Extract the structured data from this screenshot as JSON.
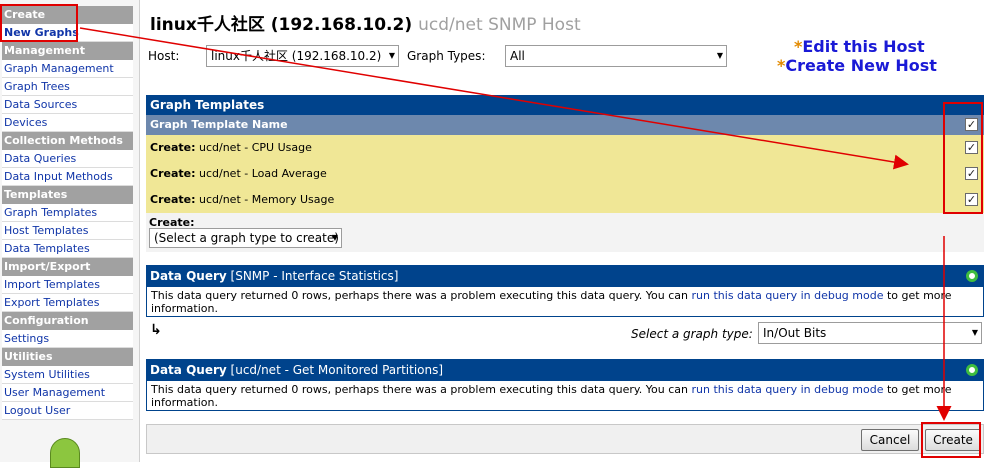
{
  "sidebar": {
    "sections": [
      {
        "title": "Create",
        "items": [
          {
            "label": "New Graphs",
            "active": true
          }
        ]
      },
      {
        "title": "Management",
        "items": [
          {
            "label": "Graph Management"
          },
          {
            "label": "Graph Trees"
          },
          {
            "label": "Data Sources"
          },
          {
            "label": "Devices"
          }
        ]
      },
      {
        "title": "Collection Methods",
        "items": [
          {
            "label": "Data Queries"
          },
          {
            "label": "Data Input Methods"
          }
        ]
      },
      {
        "title": "Templates",
        "items": [
          {
            "label": "Graph Templates"
          },
          {
            "label": "Host Templates"
          },
          {
            "label": "Data Templates"
          }
        ]
      },
      {
        "title": "Import/Export",
        "items": [
          {
            "label": "Import Templates"
          },
          {
            "label": "Export Templates"
          }
        ]
      },
      {
        "title": "Configuration",
        "items": [
          {
            "label": "Settings"
          }
        ]
      },
      {
        "title": "Utilities",
        "items": [
          {
            "label": "System Utilities"
          },
          {
            "label": "User Management"
          },
          {
            "label": "Logout User"
          }
        ]
      }
    ]
  },
  "header": {
    "title": "linux千人社区 (192.168.10.2)",
    "subtitle": "ucd/net SNMP Host"
  },
  "filters": {
    "host_label": "Host:",
    "host_value": "linux千人社区 (192.168.10.2)",
    "graph_types_label": "Graph Types:",
    "graph_types_value": "All"
  },
  "host_links": {
    "edit": "Edit this Host",
    "create": "Create New Host",
    "star": "*"
  },
  "graph_templates": {
    "title": "Graph Templates",
    "column_header": "Graph Template Name",
    "create_prefix": "Create:",
    "rows": [
      {
        "name": "ucd/net - CPU Usage",
        "checked": true
      },
      {
        "name": "ucd/net - Load Average",
        "checked": true
      },
      {
        "name": "ucd/net - Memory Usage",
        "checked": true
      }
    ],
    "create_label": "Create:",
    "create_select": "(Select a graph type to create)"
  },
  "data_queries": [
    {
      "prefix": "Data Query",
      "name": "[SNMP - Interface Statistics]",
      "message_before": "This data query returned 0 rows, perhaps there was a problem executing this data query. You can",
      "link": "run this data query in debug mode",
      "message_after": "to get more information."
    },
    {
      "prefix": "Data Query",
      "name": "[ucd/net - Get Monitored Partitions]",
      "message_before": "This data query returned 0 rows, perhaps there was a problem executing this data query. You can",
      "link": "run this data query in debug mode",
      "message_after": "to get more information."
    }
  ],
  "graph_type_select": {
    "label": "Select a graph type:",
    "value": "In/Out Bits",
    "return_arrow": "↳"
  },
  "buttons": {
    "cancel": "Cancel",
    "create": "Create"
  },
  "colors": {
    "header_blue": "#00438c",
    "row_yellow": "#f0e796",
    "annotation_red": "#e00000",
    "link_blue": "#1035a8"
  }
}
